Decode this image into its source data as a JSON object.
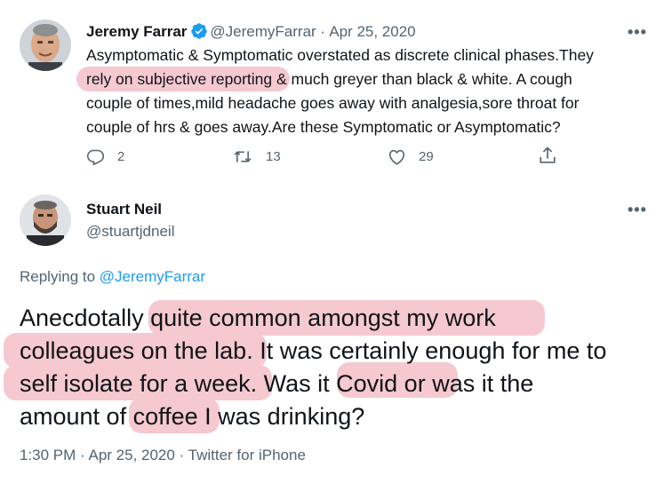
{
  "tweet1": {
    "author_name": "Jeremy Farrar",
    "handle": "@JeremyFarrar",
    "dot": "·",
    "date": "Apr 25, 2020",
    "more": "•••",
    "text_line1": "Asymptomatic & Symptomatic overstated as discrete clinical phases.They",
    "text_line2_hl": "rely on subjective reporting",
    "text_line2_rest": " & much greyer than black & white. A cough",
    "text_line3": "couple of times,mild headache goes away with analgesia,sore throat for",
    "text_line4": "couple of hrs & goes away.Are these Symptomatic or Asymptomatic?",
    "replies": "2",
    "retweets": "13",
    "likes": "29"
  },
  "tweet2": {
    "author_name": "Stuart Neil",
    "handle": "@stuartjdneil",
    "more": "•••",
    "replying_to_label": "Replying to ",
    "replying_to_handle": "@JeremyFarrar",
    "l1_a": "Anecdotally ",
    "l1_hl": "quite common amongst my work",
    "l2_hl": "colleagues on the lab.",
    "l2_rest": " It was certainly enough for me to",
    "l3_hl": "self isolate for a week.",
    "l3_b": " Was it ",
    "l3_hl2": "Covid or",
    "l3_c": " was it the",
    "l4_a": "amount of ",
    "l4_hl": "coffee",
    "l4_b": " I was drinking?",
    "meta": "1:30 PM · Apr 25, 2020 · Twitter for iPhone"
  },
  "colors": {
    "highlight": "#f5c9cf",
    "link": "#1d9bf0",
    "muted": "#536471"
  }
}
